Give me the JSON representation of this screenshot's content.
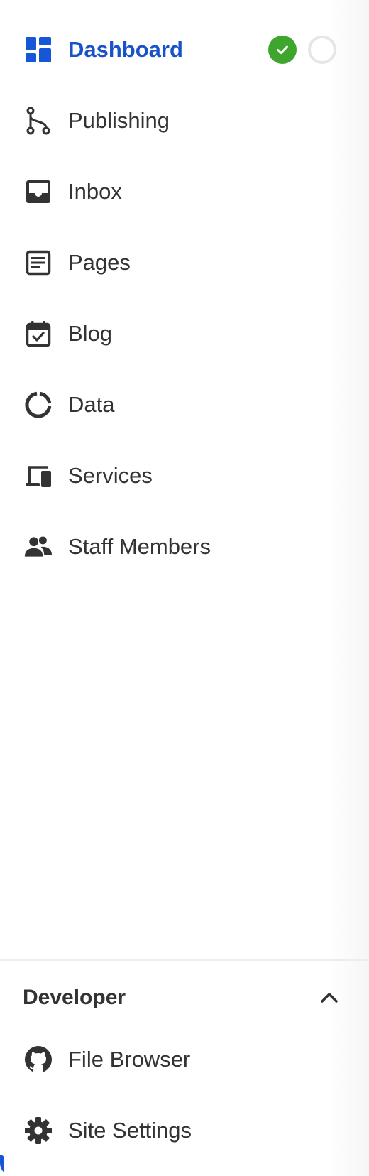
{
  "nav": {
    "items": [
      {
        "label": "Dashboard",
        "icon": "dashboard-grid-icon",
        "active": true
      },
      {
        "label": "Publishing",
        "icon": "branch-icon"
      },
      {
        "label": "Inbox",
        "icon": "inbox-icon"
      },
      {
        "label": "Pages",
        "icon": "page-icon"
      },
      {
        "label": "Blog",
        "icon": "calendar-check-icon"
      },
      {
        "label": "Data",
        "icon": "donut-chart-icon"
      },
      {
        "label": "Services",
        "icon": "devices-icon"
      },
      {
        "label": "Staff Members",
        "icon": "users-icon"
      }
    ],
    "dashboard_status": {
      "complete_icon": "check-circle-icon",
      "pending_icon": "empty-circle-icon"
    }
  },
  "developer": {
    "title": "Developer",
    "toggle_icon": "chevron-up-icon",
    "items": [
      {
        "label": "File Browser",
        "icon": "github-icon"
      },
      {
        "label": "Site Settings",
        "icon": "gear-icon"
      }
    ]
  },
  "colors": {
    "accent": "#1a52c9",
    "text": "#333333",
    "success": "#3fa62d",
    "divider": "#ededed"
  }
}
